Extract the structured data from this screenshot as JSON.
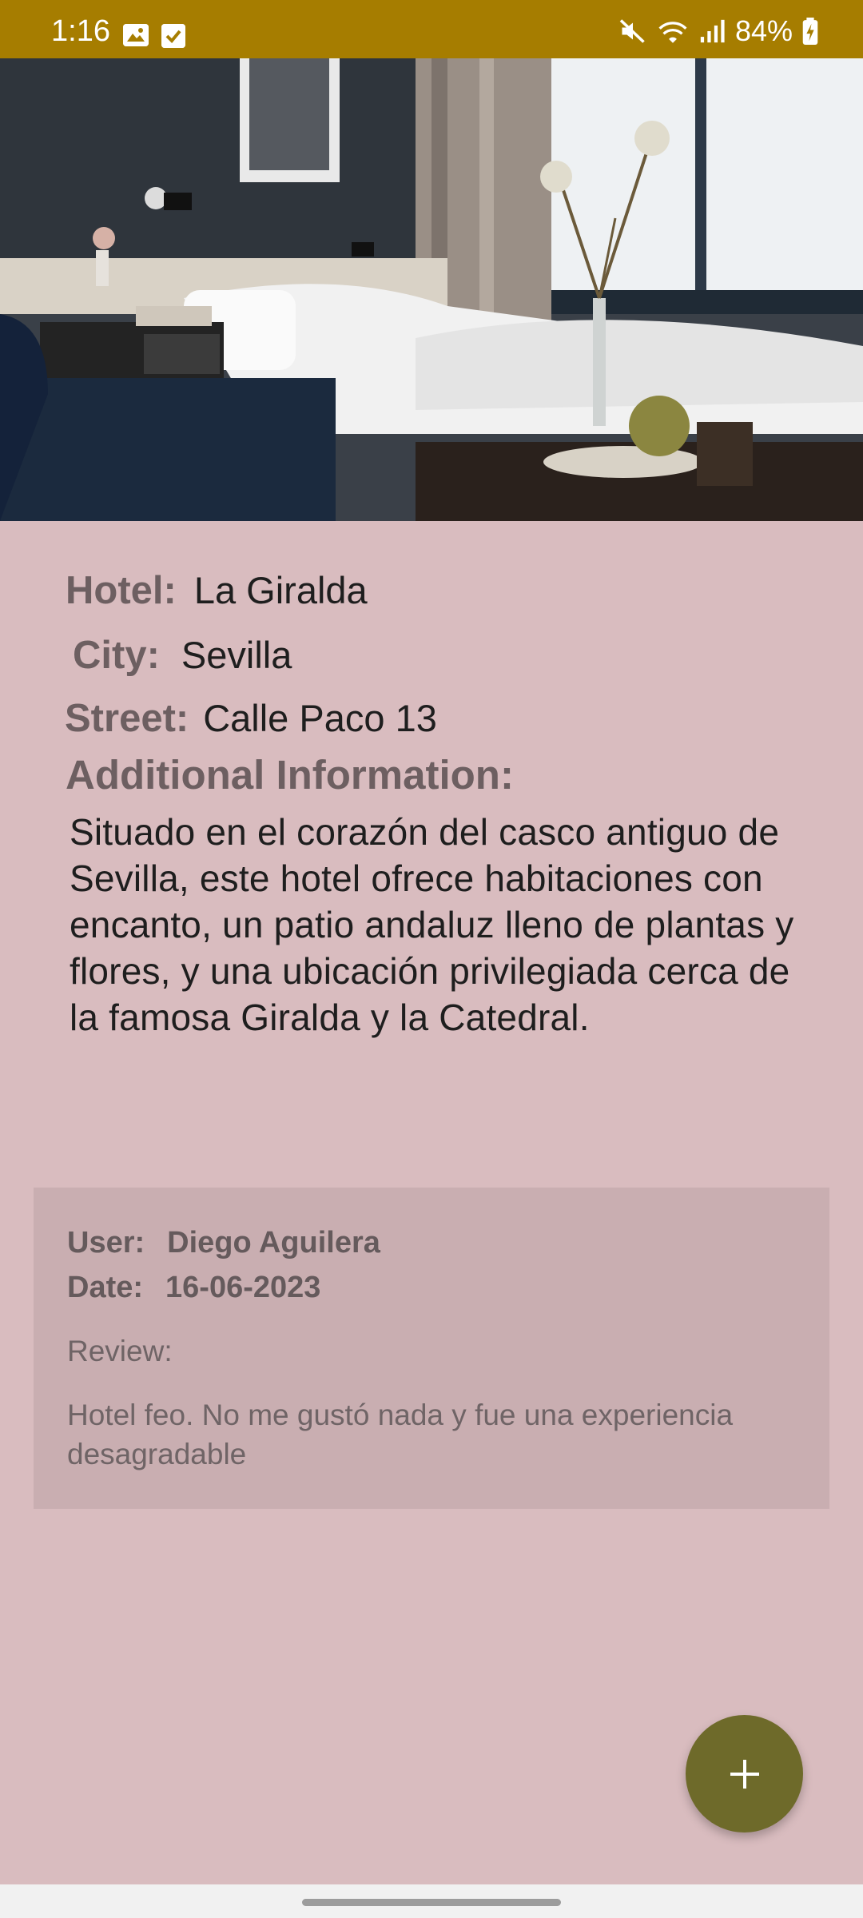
{
  "status_bar": {
    "time": "1:16",
    "battery": "84%",
    "icons": [
      "image-icon",
      "checkbox-icon",
      "mute-icon",
      "wifi-icon",
      "signal-icon",
      "battery-charging-icon"
    ]
  },
  "hero": {
    "icon": "hotel-room-photo"
  },
  "hotel": {
    "hotel_label": "Hotel:",
    "hotel_value": "La Giralda",
    "city_label": "City:",
    "city_value": "Sevilla",
    "street_label": "Street:",
    "street_value": "Calle Paco 13",
    "additional_label": "Additional Information:",
    "additional_text": "Situado en el corazón del casco antiguo de Sevilla, este hotel ofrece habitaciones con encanto, un patio andaluz lleno de plantas y flores, y una ubicación privilegiada cerca de la famosa Giralda y la Catedral."
  },
  "review": {
    "user_label": "User:",
    "user_value": "Diego Aguilera",
    "date_label": "Date:",
    "date_value": "16-06-2023",
    "review_label": "Review:",
    "review_text": "Hotel feo. No me gustó nada y fue una experiencia desagradable"
  },
  "fab": {
    "icon": "plus-icon"
  },
  "colors": {
    "status_bar": "#a67d00",
    "background": "#d9bcbf",
    "card": "#c9aeb1",
    "fab": "#6e6a2a"
  }
}
